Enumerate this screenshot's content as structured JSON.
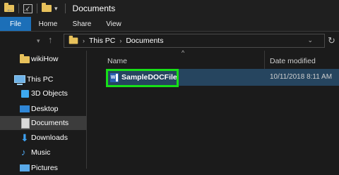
{
  "window": {
    "title": "Documents"
  },
  "ribbon": {
    "tabs": [
      "File",
      "Home",
      "Share",
      "View"
    ]
  },
  "address": {
    "crumbs": [
      "This PC",
      "Documents"
    ]
  },
  "sidebar": {
    "items": [
      {
        "label": "wikiHow",
        "icon": "folder-icon"
      },
      {
        "label": "This PC",
        "icon": "computer-icon"
      },
      {
        "label": "3D Objects",
        "icon": "3d-objects-icon"
      },
      {
        "label": "Desktop",
        "icon": "desktop-icon"
      },
      {
        "label": "Documents",
        "icon": "documents-icon",
        "selected": true
      },
      {
        "label": "Downloads",
        "icon": "downloads-icon"
      },
      {
        "label": "Music",
        "icon": "music-icon"
      },
      {
        "label": "Pictures",
        "icon": "pictures-icon"
      }
    ]
  },
  "columns": {
    "name": "Name",
    "date": "Date modified"
  },
  "files": [
    {
      "name": "SampleDOCFile",
      "date_modified": "10/11/2018 8:11 AM",
      "icon": "word-document-icon",
      "highlighted": true
    }
  ],
  "colors": {
    "file_tab": "#1c6fb8",
    "highlight": "#17e017",
    "selection": "#26455f"
  }
}
